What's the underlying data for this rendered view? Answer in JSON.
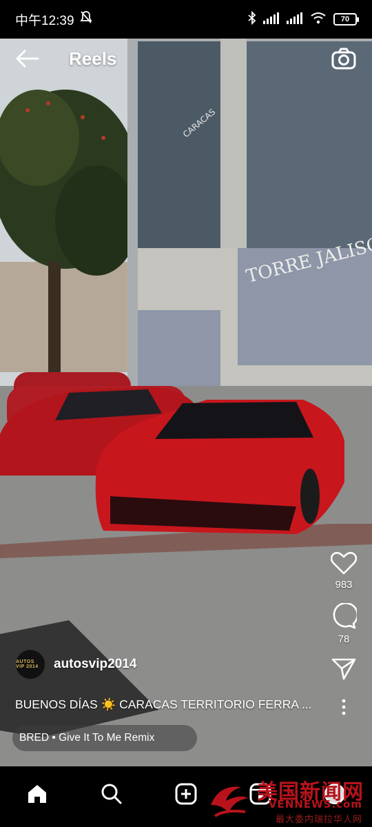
{
  "status_bar": {
    "time": "中午12:39",
    "icons": [
      "mute-icon",
      "bluetooth-icon",
      "signal-icon",
      "signal-icon",
      "wifi-icon"
    ],
    "battery": "70"
  },
  "header": {
    "title": "Reels",
    "back_icon": "back-arrow-icon",
    "camera_icon": "camera-icon"
  },
  "actions": {
    "like_count": "983",
    "comment_count": "78"
  },
  "post": {
    "username": "autosvip2014",
    "avatar_text": "AUTOS VIP 2014",
    "caption": "BUENOS DÍAS ☀️ CARACAS TERRITORIO FERRA ...",
    "audio": "BRED • Give It To Me Remix"
  },
  "bottom_nav": [
    "home-icon",
    "search-icon",
    "create-icon",
    "reels-icon",
    "profile-avatar"
  ],
  "watermark": {
    "title": "美国新闻网",
    "domain": "VENNEWS.com",
    "subtitle": "最大委内瑞拉华人网"
  },
  "colors": {
    "accent_red": "#c8161d",
    "background": "#000000"
  }
}
